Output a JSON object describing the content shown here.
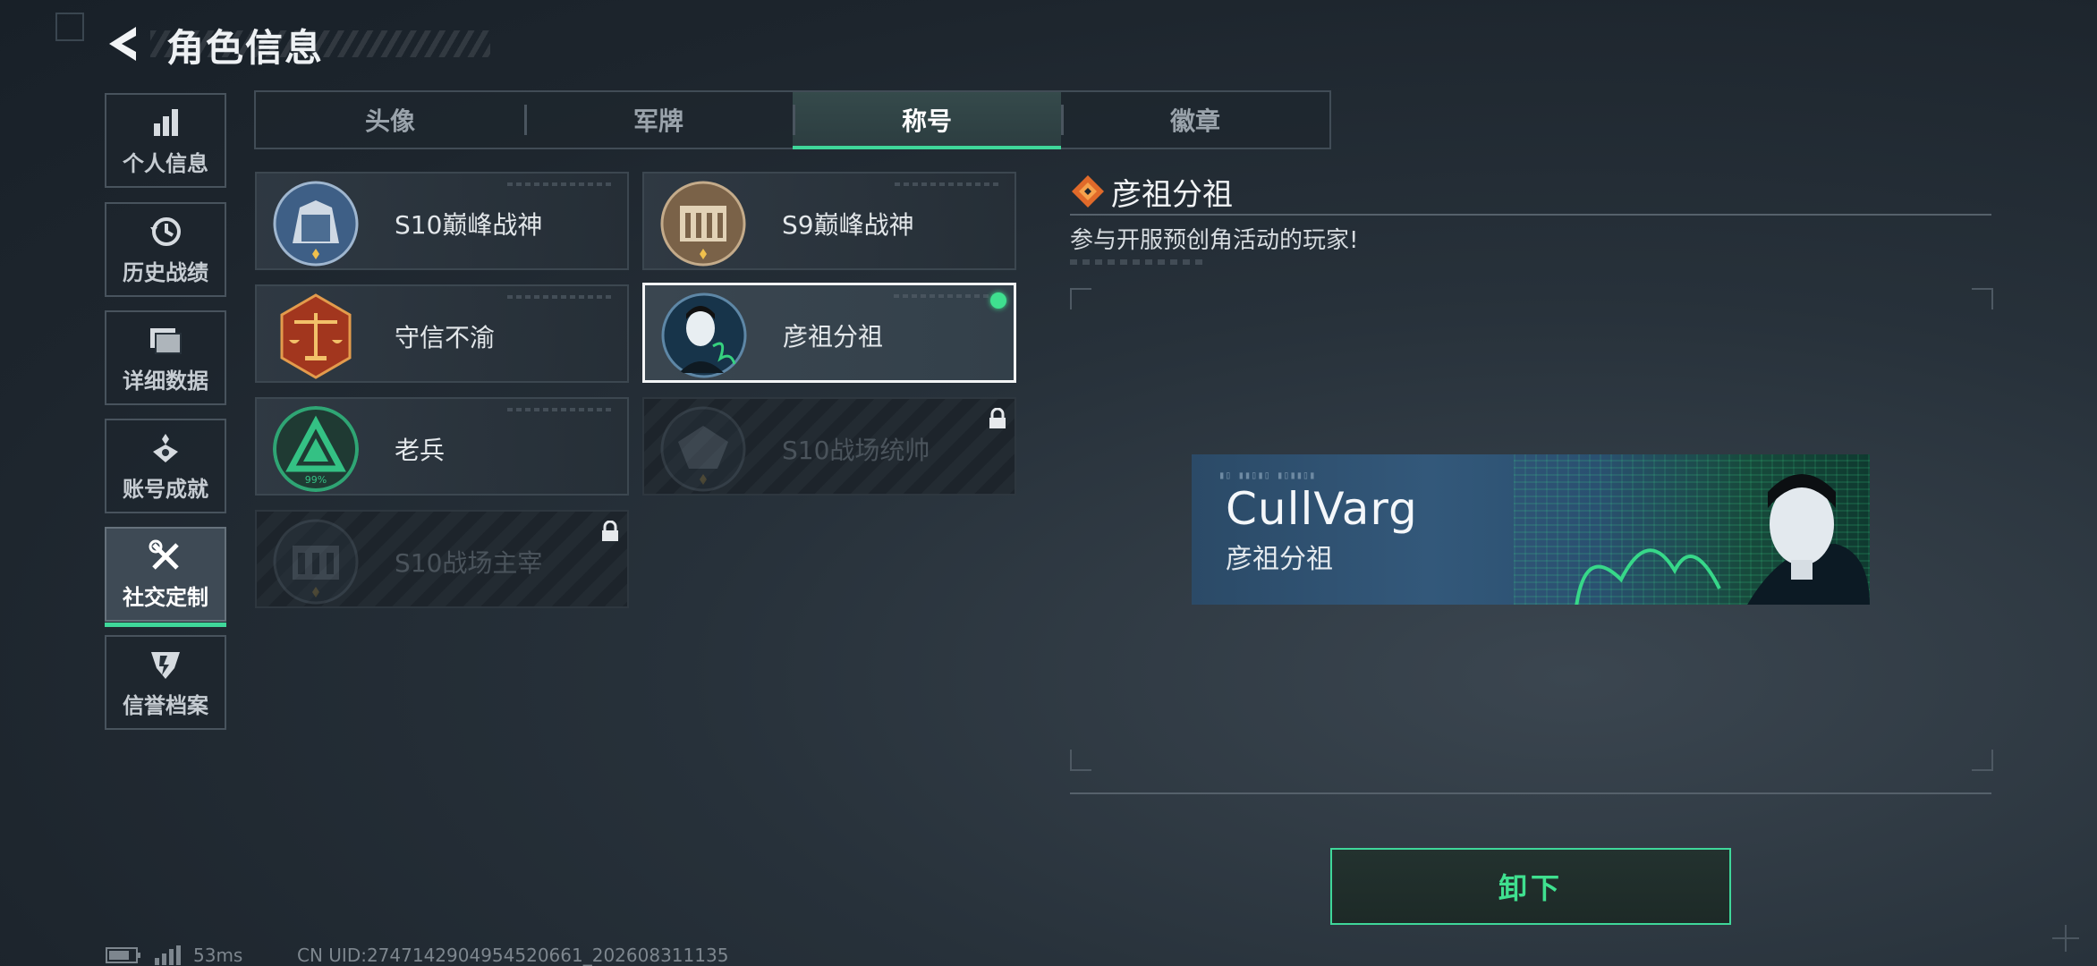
{
  "header": {
    "title": "角色信息"
  },
  "sidebar": {
    "items": [
      {
        "label": "个人信息",
        "icon": "bar-chart-icon"
      },
      {
        "label": "历史战绩",
        "icon": "history-icon"
      },
      {
        "label": "详细数据",
        "icon": "folder-icon"
      },
      {
        "label": "账号成就",
        "icon": "achievement-icon"
      },
      {
        "label": "社交定制",
        "icon": "tools-icon",
        "active": true
      },
      {
        "label": "信誉档案",
        "icon": "shield-icon"
      }
    ]
  },
  "tabs": [
    {
      "label": "头像"
    },
    {
      "label": "军牌"
    },
    {
      "label": "称号",
      "active": true
    },
    {
      "label": "徽章"
    }
  ],
  "titles": [
    {
      "name": "S10巅峰战神",
      "locked": false
    },
    {
      "name": "S9巅峰战神",
      "locked": false
    },
    {
      "name": "守信不渝",
      "locked": false
    },
    {
      "name": "彦祖分祖",
      "locked": false,
      "selected": true,
      "equipped": true
    },
    {
      "name": "老兵",
      "locked": false,
      "emblem_text": "99%"
    },
    {
      "name": "S10战场统帅",
      "locked": true
    },
    {
      "name": "S10战场主宰",
      "locked": true
    }
  ],
  "detail": {
    "title": "彦祖分祖",
    "description": "参与开服预创角活动的玩家!",
    "banner": {
      "nickname": "CullVarg",
      "title": "彦祖分祖"
    }
  },
  "unequip_label": "卸下",
  "status": {
    "ping": "53ms",
    "uid": "CN UID:2747142904954520661_202608311135"
  },
  "colors": {
    "accent": "#3fd79a",
    "equipped_dot": "#3fe08f"
  }
}
